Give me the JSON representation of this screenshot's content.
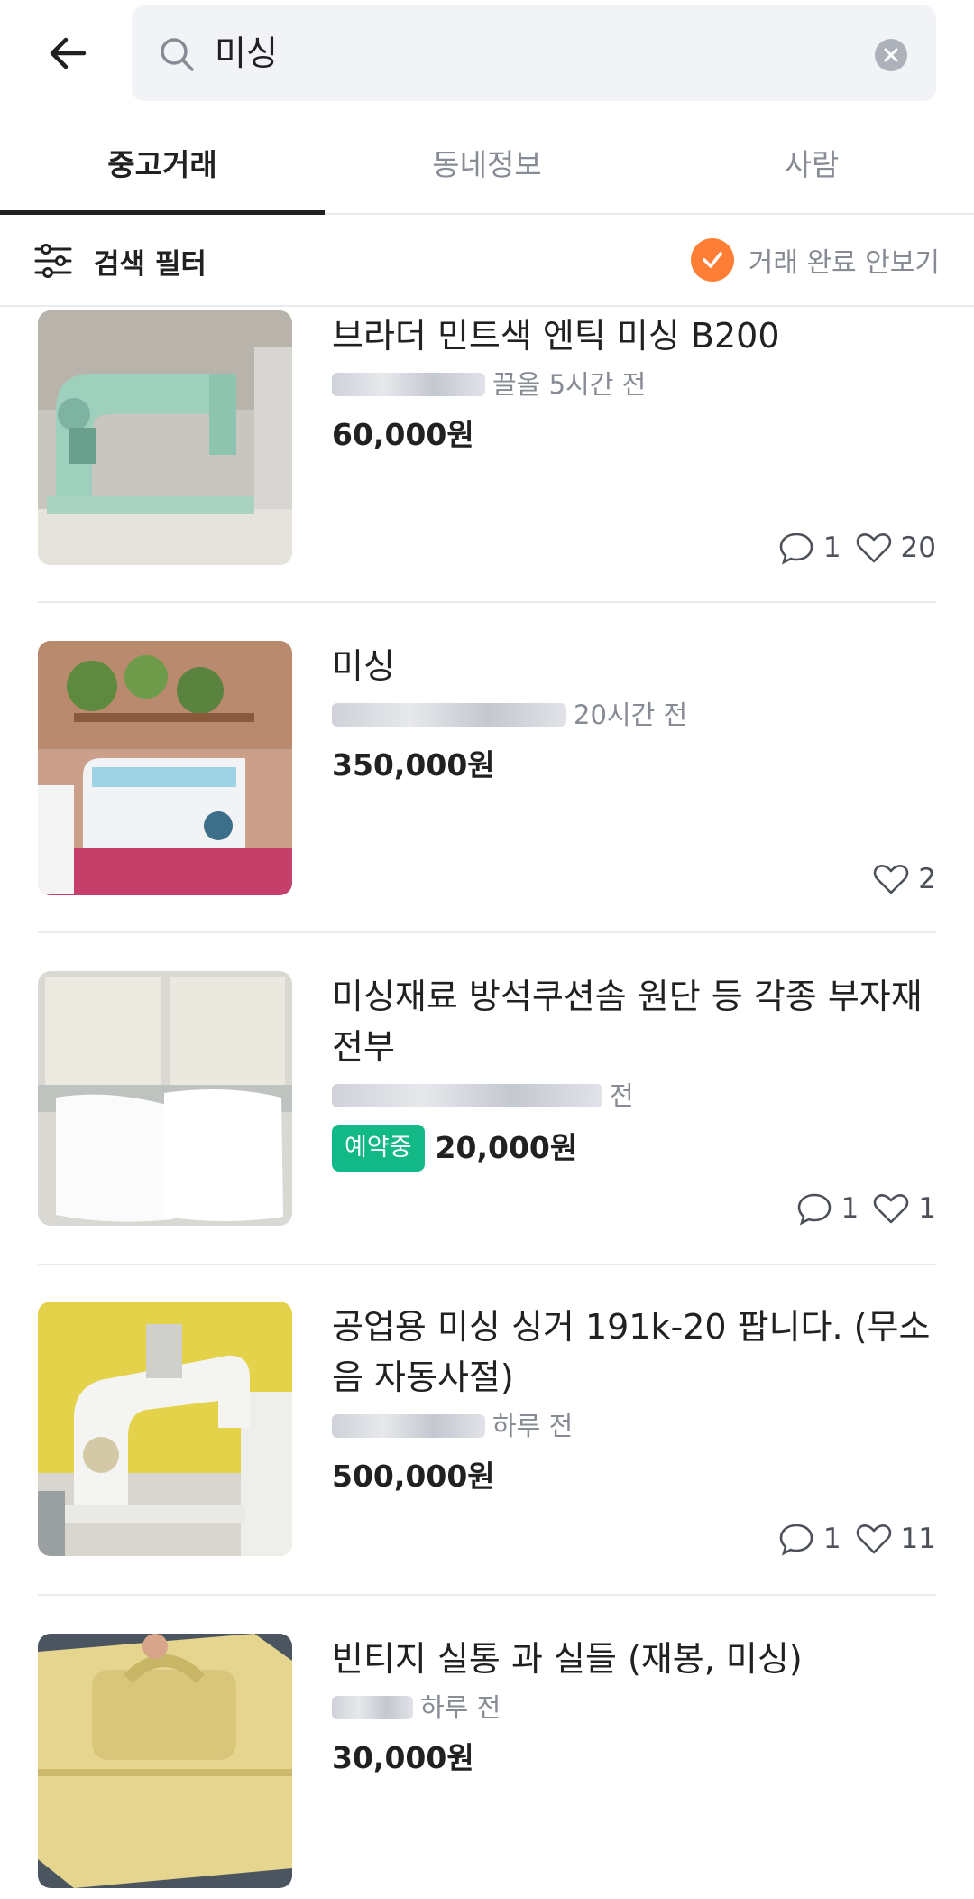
{
  "search": {
    "query": "미싱"
  },
  "tabs": [
    {
      "label": "중고거래",
      "active": true
    },
    {
      "label": "동네정보",
      "active": false
    },
    {
      "label": "사람",
      "active": false
    }
  ],
  "filter": {
    "label": "검색 필터",
    "hide_completed_label": "거래 완료 안보기",
    "hide_completed_checked": true
  },
  "colors": {
    "accent": "#ff7e36",
    "reserved_badge": "#12b886",
    "text": "#212124",
    "muted": "#868b94"
  },
  "items": [
    {
      "title": "브라더 민트색 엔틱 미싱 B200",
      "location": "하성시 ㅂㅂㄷ",
      "time": "끌올 5시간 전",
      "price": "60,000원",
      "status": "",
      "chats": "1",
      "likes": "20"
    },
    {
      "title": "미싱",
      "location": "ㅇ ㅂ ㄱ ㅁ",
      "time": "20시간 전",
      "price": "350,000원",
      "status": "",
      "chats": "",
      "likes": "2"
    },
    {
      "title": "미싱재료 방석쿠션솜 원단 등 각종 부자재 전부",
      "location": "하성시 도당",
      "time": "전",
      "price": "20,000원",
      "status": "예약중",
      "chats": "1",
      "likes": "1"
    },
    {
      "title": "공업용 미싱 싱거 191k-20 팝니다. (무소음 자동사절)",
      "location": "ㅇㅇ ㅇ",
      "time": "하루 전",
      "price": "500,000원",
      "status": "",
      "chats": "1",
      "likes": "11"
    },
    {
      "title": "빈티지 실통 과 실들 (재봉, 미싱)",
      "location": "ㅁㅁ",
      "time": "하루 전",
      "price": "30,000원",
      "status": "",
      "chats": "",
      "likes": ""
    }
  ]
}
